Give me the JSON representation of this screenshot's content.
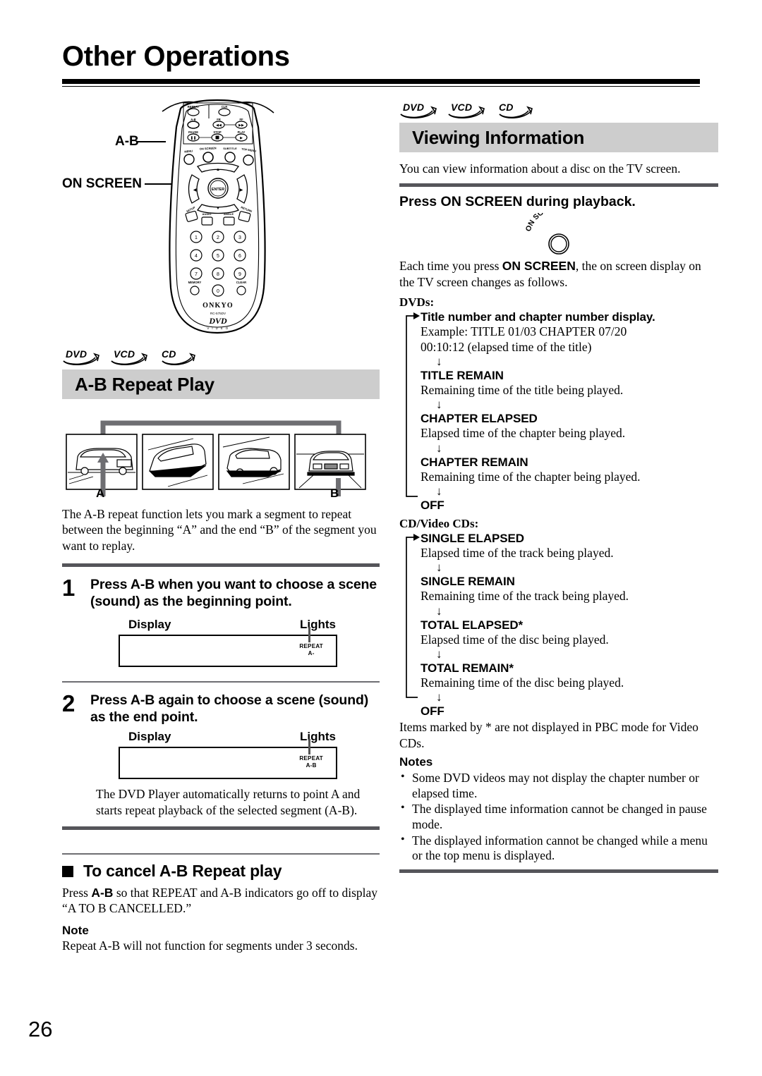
{
  "page": {
    "title": "Other Operations",
    "number": "26"
  },
  "left": {
    "remote": {
      "callout_ab": "A-B",
      "callout_onscreen": "ON SCREEN",
      "brand": "ONKYO",
      "model": "RC-575DV",
      "logo": "DVD",
      "logo_sub": "V I D E O",
      "buttons": {
        "repeat": "REPEAT",
        "ab": "A-B",
        "fr": "FR",
        "ff": "FF",
        "pause": "PAUSE",
        "stop": "STOP",
        "play": "PLAY",
        "menu": "MENU",
        "onscreen": "ON SCREEN",
        "subtitle": "SUBTITLE",
        "topmenu": "TOP MENU",
        "setup": "SETUP",
        "audio": "AUDIO",
        "angle": "ANGLE",
        "return": "RETURN",
        "enter": "ENTER",
        "memory": "MEMORY",
        "clear": "CLEAR",
        "keys": [
          "1",
          "2",
          "3",
          "4",
          "5",
          "6",
          "7",
          "8",
          "9",
          "0"
        ]
      }
    },
    "discs": [
      "DVD",
      "VCD",
      "CD"
    ],
    "section_title": "A-B Repeat Play",
    "diagram": {
      "marker_a": "A",
      "marker_b": "B"
    },
    "intro": "The A-B repeat function lets you mark a segment to repeat between the beginning “A” and the end “B” of the segment you want to replay.",
    "steps": [
      {
        "num": "1",
        "text": "Press A-B when you want to choose a scene (sound) as the beginning point.",
        "display_label": "Display",
        "lights_label": "Lights",
        "indicator_line1": "REPEAT",
        "indicator_line2": "A-"
      },
      {
        "num": "2",
        "text": "Press A-B again to choose a scene (sound) as the end point.",
        "display_label": "Display",
        "lights_label": "Lights",
        "indicator_line1": "REPEAT",
        "indicator_line2": "A-B"
      }
    ],
    "step2_note": "The DVD Player automatically returns to point A and starts repeat playback of the selected segment (A-B).",
    "cancel": {
      "heading": "To cancel A-B Repeat play",
      "text_before": "Press ",
      "text_bold": "A-B",
      "text_after": " so that REPEAT and A-B indicators go off to display “A TO B CANCELLED.”",
      "note_heading": "Note",
      "note_text": "Repeat A-B will not function for segments under 3 seconds."
    }
  },
  "right": {
    "discs": [
      "DVD",
      "VCD",
      "CD"
    ],
    "section_title": "Viewing Information",
    "intro": "You can view information about a disc on the TV screen.",
    "instruction": "Press ON SCREEN during playback.",
    "button_label": "ON SCREEN",
    "each_time": {
      "before": "Each time you press ",
      "bold": "ON SCREEN",
      "after": ", the on screen display on the TV screen changes as follows."
    },
    "dvd_group": {
      "label": "DVDs:",
      "items": [
        {
          "title": "Title number and chapter number display.",
          "desc": "Example: TITLE 01/03 CHAPTER 07/20\n00:10:12 (elapsed time of the title)"
        },
        {
          "title": "TITLE REMAIN",
          "desc": "Remaining time of the title being played."
        },
        {
          "title": "CHAPTER ELAPSED",
          "desc": "Elapsed time of the chapter being played."
        },
        {
          "title": "CHAPTER REMAIN",
          "desc": "Remaining time of the chapter being played."
        },
        {
          "title": "OFF",
          "desc": ""
        }
      ]
    },
    "cd_group": {
      "label": "CD/Video CDs:",
      "items": [
        {
          "title": "SINGLE ELAPSED",
          "desc": "Elapsed time of the track being played."
        },
        {
          "title": "SINGLE REMAIN",
          "desc": "Remaining time of the track being played."
        },
        {
          "title": "TOTAL ELAPSED*",
          "desc": "Elapsed time of the disc being played."
        },
        {
          "title": "TOTAL REMAIN*",
          "desc": "Remaining time of the disc being played."
        },
        {
          "title": "OFF",
          "desc": ""
        }
      ]
    },
    "footnote": "Items marked by * are not displayed in PBC mode for Video CDs.",
    "notes_heading": "Notes",
    "notes": [
      "Some DVD videos may not display the chapter number or elapsed time.",
      "The displayed time information cannot be changed in pause mode.",
      "The displayed information cannot be changed while a menu or the top menu is displayed."
    ]
  },
  "colors": {
    "heading_bar": "#cdcdcd",
    "rule": "#55555a",
    "arrow_gray": "#6e6e72"
  }
}
